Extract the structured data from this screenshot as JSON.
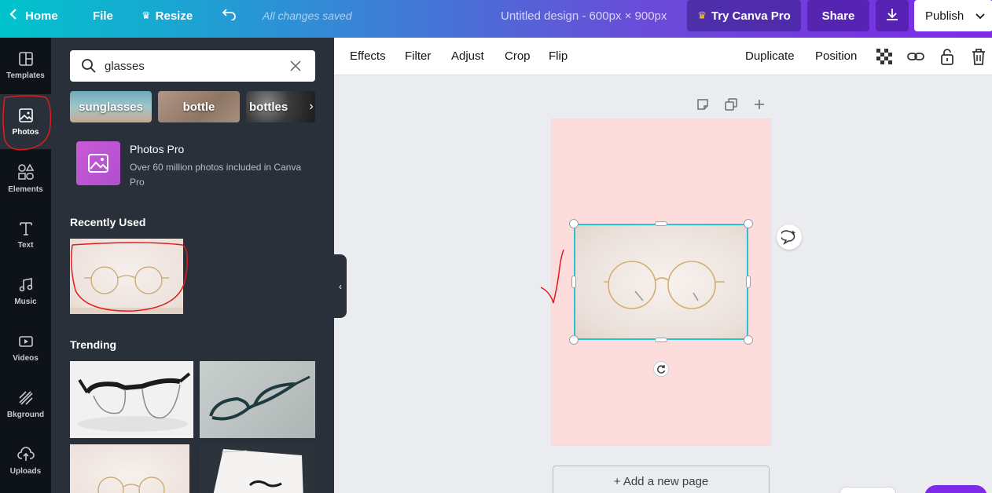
{
  "topbar": {
    "home": "Home",
    "file": "File",
    "resize": "Resize",
    "saved_status": "All changes saved",
    "design_title": "Untitled design - 600px × 900px",
    "try_pro": "Try Canva Pro",
    "share": "Share",
    "publish": "Publish"
  },
  "rail": {
    "items": [
      {
        "label": "Templates",
        "icon": "templates-icon"
      },
      {
        "label": "Photos",
        "icon": "photos-icon"
      },
      {
        "label": "Elements",
        "icon": "elements-icon"
      },
      {
        "label": "Text",
        "icon": "text-icon"
      },
      {
        "label": "Music",
        "icon": "music-icon"
      },
      {
        "label": "Videos",
        "icon": "videos-icon"
      },
      {
        "label": "Bkground",
        "icon": "background-icon"
      },
      {
        "label": "Uploads",
        "icon": "uploads-icon"
      }
    ]
  },
  "panel": {
    "search_value": "glasses",
    "chips": [
      "sunglasses",
      "bottle",
      "bottles"
    ],
    "pro_title": "Photos Pro",
    "pro_desc": "Over 60 million photos included in Canva Pro",
    "recently_used": "Recently Used",
    "trending": "Trending"
  },
  "toolbar": {
    "effects": "Effects",
    "filter": "Filter",
    "adjust": "Adjust",
    "crop": "Crop",
    "flip": "Flip",
    "duplicate": "Duplicate",
    "position": "Position"
  },
  "canvas": {
    "add_page": "+ Add a new page",
    "page_color": "#fddcdc",
    "selection_color": "#23c4d3"
  },
  "colors": {
    "accent_purple": "#7d2ae8",
    "rail_bg": "#0e1318",
    "panel_bg": "#293039"
  }
}
